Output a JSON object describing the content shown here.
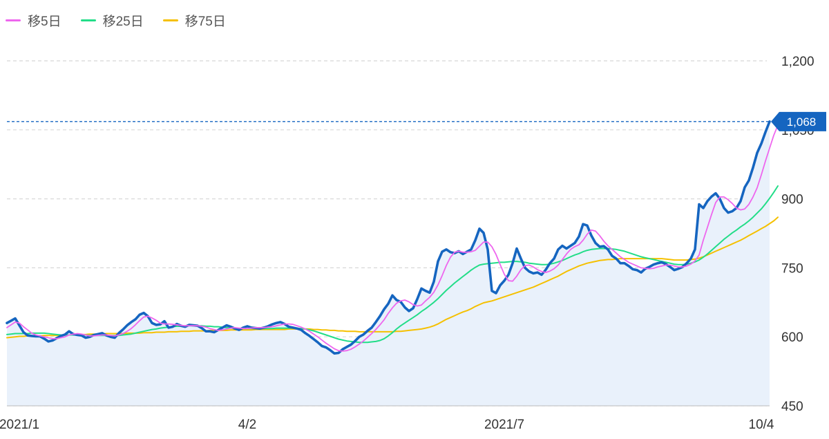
{
  "legend": [
    {
      "label": "移5日",
      "color": "#ee66ee"
    },
    {
      "label": "移25日",
      "color": "#22dd88"
    },
    {
      "label": "移75日",
      "color": "#f5c000"
    }
  ],
  "colors": {
    "price": "#1565c0",
    "area": "#e9f1fb",
    "grid": "#d8d8d8",
    "current_line": "#1565c0",
    "badge": "#1565c0"
  },
  "chart_data": {
    "type": "line",
    "ylim": [
      450,
      1200
    ],
    "y_ticks": [
      {
        "value": 450,
        "label": "450"
      },
      {
        "value": 600,
        "label": "600"
      },
      {
        "value": 750,
        "label": "750"
      },
      {
        "value": 900,
        "label": "900"
      },
      {
        "value": 1050,
        "label": "1,050"
      },
      {
        "value": 1200,
        "label": "1,200"
      }
    ],
    "x_ticks": [
      {
        "index": 3,
        "label": "2021/1"
      },
      {
        "index": 58,
        "label": "4/2"
      },
      {
        "index": 120,
        "label": "2021/7"
      },
      {
        "index": 182,
        "label": "10/4"
      }
    ],
    "current_price": 1068,
    "current_price_label": "1,068",
    "price": [
      630,
      635,
      640,
      625,
      610,
      603,
      602,
      601,
      601,
      596,
      590,
      592,
      597,
      602,
      605,
      612,
      606,
      604,
      603,
      598,
      600,
      604,
      606,
      608,
      603,
      600,
      598,
      608,
      616,
      625,
      632,
      638,
      648,
      652,
      645,
      630,
      626,
      627,
      634,
      620,
      622,
      628,
      624,
      622,
      626,
      625,
      624,
      619,
      612,
      612,
      610,
      615,
      620,
      625,
      622,
      618,
      615,
      620,
      623,
      620,
      619,
      618,
      620,
      623,
      627,
      630,
      632,
      628,
      622,
      620,
      618,
      615,
      608,
      602,
      595,
      588,
      580,
      577,
      571,
      564,
      565,
      573,
      578,
      583,
      591,
      600,
      605,
      613,
      620,
      632,
      645,
      660,
      672,
      690,
      680,
      676,
      664,
      656,
      662,
      682,
      705,
      700,
      696,
      720,
      764,
      785,
      790,
      784,
      782,
      786,
      780,
      785,
      790,
      810,
      835,
      826,
      790,
      700,
      695,
      712,
      722,
      735,
      760,
      792,
      770,
      750,
      742,
      738,
      740,
      735,
      746,
      760,
      770,
      790,
      798,
      792,
      798,
      804,
      818,
      845,
      842,
      820,
      804,
      796,
      797,
      790,
      776,
      770,
      760,
      760,
      754,
      747,
      745,
      740,
      748,
      752,
      757,
      760,
      762,
      758,
      752,
      745,
      748,
      752,
      760,
      770,
      790,
      888,
      880,
      895,
      905,
      912,
      900,
      880,
      870,
      873,
      880,
      895,
      925,
      940,
      968,
      1000,
      1020,
      1045,
      1068
    ],
    "ma5": [
      620,
      626,
      632,
      630,
      622,
      615,
      608,
      604,
      602,
      600,
      598,
      596,
      596,
      598,
      600,
      604,
      606,
      607,
      606,
      604,
      602,
      602,
      603,
      604,
      604,
      603,
      602,
      604,
      607,
      612,
      618,
      626,
      635,
      643,
      645,
      641,
      636,
      630,
      628,
      628,
      627,
      626,
      625,
      624,
      624,
      624,
      624,
      623,
      621,
      618,
      616,
      614,
      615,
      617,
      619,
      620,
      619,
      618,
      618,
      619,
      620,
      620,
      620,
      621,
      622,
      624,
      626,
      628,
      628,
      627,
      624,
      621,
      617,
      612,
      606,
      600,
      593,
      586,
      580,
      574,
      570,
      569,
      570,
      573,
      578,
      584,
      591,
      599,
      607,
      616,
      626,
      637,
      651,
      663,
      673,
      678,
      680,
      676,
      670,
      667,
      669,
      678,
      686,
      697,
      713,
      733,
      755,
      773,
      784,
      786,
      784,
      784,
      785,
      788,
      797,
      806,
      806,
      796,
      779,
      757,
      736,
      722,
      721,
      732,
      746,
      755,
      756,
      752,
      746,
      742,
      740,
      743,
      748,
      756,
      768,
      780,
      790,
      796,
      800,
      810,
      823,
      832,
      830,
      820,
      808,
      798,
      790,
      782,
      774,
      768,
      762,
      758,
      754,
      750,
      749,
      748,
      749,
      752,
      754,
      756,
      756,
      754,
      752,
      752,
      754,
      758,
      765,
      778,
      810,
      838,
      866,
      892,
      904,
      904,
      898,
      890,
      880,
      876,
      878,
      888,
      904,
      924,
      952,
      982,
      1010,
      1038,
      1060
    ],
    "ma25": [
      605,
      606,
      607,
      607,
      607,
      607,
      608,
      608,
      608,
      608,
      607,
      606,
      605,
      604,
      604,
      604,
      604,
      605,
      605,
      604,
      603,
      603,
      603,
      603,
      603,
      603,
      603,
      603,
      604,
      605,
      606,
      608,
      610,
      612,
      614,
      616,
      617,
      619,
      620,
      621,
      622,
      623,
      623,
      624,
      624,
      624,
      624,
      624,
      623,
      623,
      622,
      622,
      621,
      620,
      619,
      619,
      618,
      618,
      618,
      618,
      618,
      618,
      618,
      618,
      618,
      619,
      619,
      619,
      619,
      619,
      619,
      618,
      617,
      615,
      613,
      610,
      607,
      604,
      601,
      598,
      595,
      593,
      591,
      590,
      589,
      588,
      588,
      588,
      589,
      590,
      592,
      596,
      602,
      609,
      617,
      624,
      630,
      636,
      642,
      648,
      655,
      661,
      668,
      675,
      683,
      692,
      701,
      709,
      717,
      724,
      731,
      738,
      745,
      751,
      756,
      758,
      759,
      760,
      761,
      762,
      762,
      763,
      764,
      764,
      763,
      762,
      760,
      759,
      758,
      757,
      757,
      758,
      760,
      763,
      766,
      770,
      774,
      778,
      781,
      785,
      788,
      790,
      791,
      792,
      792,
      792,
      791,
      790,
      788,
      786,
      783,
      780,
      777,
      774,
      772,
      770,
      768,
      766,
      764,
      762,
      760,
      758,
      757,
      757,
      758,
      760,
      763,
      767,
      773,
      780,
      788,
      796,
      804,
      812,
      819,
      826,
      832,
      839,
      845,
      852,
      860,
      869,
      878,
      889,
      901,
      914,
      928
    ],
    "ma75": [
      598,
      599,
      600,
      601,
      601,
      602,
      602,
      602,
      602,
      603,
      603,
      603,
      603,
      604,
      604,
      604,
      605,
      605,
      605,
      605,
      606,
      606,
      606,
      606,
      607,
      607,
      607,
      607,
      607,
      608,
      608,
      608,
      608,
      609,
      609,
      609,
      610,
      610,
      610,
      611,
      611,
      611,
      612,
      612,
      612,
      613,
      613,
      613,
      613,
      614,
      614,
      614,
      614,
      614,
      615,
      615,
      615,
      615,
      615,
      615,
      616,
      616,
      616,
      616,
      616,
      616,
      616,
      616,
      617,
      617,
      617,
      617,
      617,
      617,
      616,
      616,
      615,
      615,
      614,
      614,
      613,
      613,
      612,
      612,
      612,
      611,
      611,
      611,
      611,
      611,
      611,
      611,
      611,
      611,
      612,
      612,
      613,
      614,
      615,
      616,
      617,
      619,
      621,
      624,
      628,
      633,
      638,
      642,
      646,
      650,
      654,
      657,
      661,
      666,
      670,
      674,
      676,
      678,
      681,
      684,
      687,
      690,
      693,
      696,
      699,
      702,
      705,
      708,
      712,
      716,
      720,
      724,
      728,
      732,
      737,
      742,
      746,
      750,
      754,
      757,
      760,
      762,
      764,
      766,
      767,
      768,
      768,
      769,
      770,
      770,
      770,
      770,
      770,
      770,
      770,
      770,
      770,
      770,
      770,
      769,
      768,
      767,
      767,
      767,
      767,
      768,
      769,
      771,
      774,
      778,
      782,
      786,
      790,
      794,
      798,
      802,
      806,
      810,
      815,
      820,
      825,
      830,
      835,
      840,
      846,
      852,
      860
    ]
  }
}
